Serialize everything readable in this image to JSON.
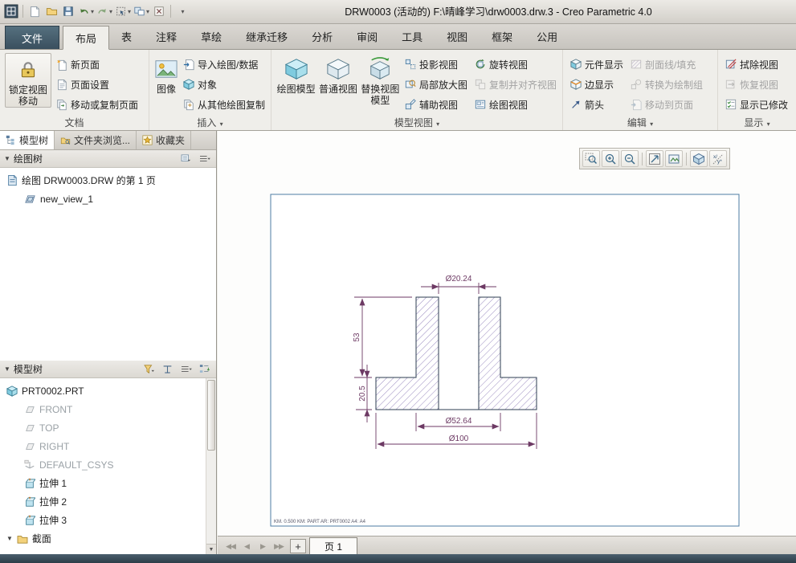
{
  "titlebar": {
    "title": "DRW0003 (活动的) F:\\晴峰学习\\drw0003.drw.3 - Creo Parametric 4.0"
  },
  "ribbon_tabs": [
    "文件",
    "布局",
    "表",
    "注释",
    "草绘",
    "继承迁移",
    "分析",
    "审阅",
    "工具",
    "视图",
    "框架",
    "公用"
  ],
  "doc_group": {
    "label": "文档",
    "lock_line1": "锁定视图",
    "lock_line2": "移动",
    "new_page": "新页面",
    "page_setup": "页面设置",
    "move_copy_page": "移动或复制页面"
  },
  "insert_group": {
    "label": "插入",
    "image": "图像",
    "import_data": "导入绘图/数据",
    "object": "对象",
    "copy_from_other": "从其他绘图复制"
  },
  "model_views_group": {
    "label": "模型视图",
    "drawing_model": "绘图模型",
    "general_view": "普通视图",
    "replace_line1": "替换视图",
    "replace_line2": "模型",
    "projection": "投影视图",
    "detail": "局部放大图",
    "auxiliary": "辅助视图",
    "rotated": "旋转视图",
    "copy_align": "复制并对齐视图",
    "drawing_view": "绘图视图"
  },
  "edit_group": {
    "label": "编辑",
    "component_display": "元件显示",
    "edge_display": "边显示",
    "arrows": "箭头",
    "hatch": "剖面线/填充",
    "convert_draft": "转换为绘制组",
    "move_to_page": "移动到页面"
  },
  "display_group": {
    "label": "显示",
    "erase_view": "拭除视图",
    "resume_view": "恢复视图",
    "show_modified": "显示已修改"
  },
  "panel": {
    "tabs": [
      "模型树",
      "文件夹浏览...",
      "收藏夹"
    ],
    "drawing_tree_header": "绘图树",
    "drawing_tree_items": [
      "绘图 DRW0003.DRW 的第 1 页",
      "new_view_1"
    ],
    "model_tree_header": "模型树",
    "model_tree_items": [
      "PRT0002.PRT",
      "FRONT",
      "TOP",
      "RIGHT",
      "DEFAULT_CSYS",
      "拉伸 1",
      "拉伸 2",
      "拉伸 3",
      "截面"
    ]
  },
  "drawing": {
    "dim_hole": "Ø20.24",
    "dim_height": "53",
    "dim_flange_thickness": "20.5",
    "dim_hub": "Ø52.64",
    "dim_flange": "Ø100",
    "sheet_note": "KM. 0.500  KM: PART  AR: PRT0002  A4: A4"
  },
  "pagebar": {
    "page_tab": "页 1"
  }
}
